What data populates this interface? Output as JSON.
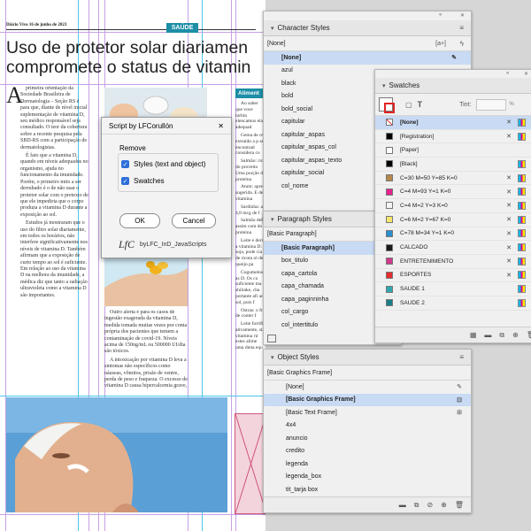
{
  "document": {
    "folio": "Diário Vivo 16 de junho de 2023",
    "section_tag": "SAÚDE",
    "headline_line1": "Uso de protetor solar diariamen",
    "headline_line2": "compromete o status de vitamin",
    "sidebar_title": "Aliment",
    "dropcap": "A",
    "column1": [
      "primeira orientação da Sociedade Brasileira de Dermatologia – Seção RS é para que, diante de nível inicial suplementação de vitamina D, seu médico responsável seja consultado. O teor da cobertura sobre a recente pesquisa pela SBD-RS com a participação de dermatologistas.",
      "É fato que a vitamina D, quando em níveis adequados no organismo, ajuda no funcionamento da imunidade. Porém, o primeiro mito a ser derrubado é o de não usar o protetor solar com o pretexto de que ele impediria que o corpo produza a vitamina D durante a exposição ao sol.",
      "Estudos já mostraram que o uso do filtro solar diariamente, em todos os horários, não interfere significativamente nos níveis de vitamina D. Também afirmam que a exposição de curto tempo ao sol é suficiente. Em relação ao uso da vitamina D na melhora da imunidade, a médica diz que tanto a radiação ultravioleta como a vitamina D são importantes."
    ],
    "column2": [
      "Outro alerta é para os casos de ingestão exagerada da vitamina D, medida tomada muitas vezes por conta própria dos pacientes que temem a contaminação de covid-19. Níveis acima de 150ng/mL ou 500000 UI/dia são tóxicos.",
      "A intoxicação por vitamina D leva a sintomas não específicos como náuseas, vômitos, prisão de ventre, perda de peso e fraqueza. O excesso de vitamina D causa hipercalcemia grave, que pode levar a lesões renal, arritmia cardíaca e manifestações neurológicas."
    ],
    "column3": [
      "Ao saber que voce turbin elencamos elas adequad",
      "Gema de ov extraído a p ser encontrad considera co",
      "Salmão: ric do proveito Uma porção de proteína",
      "Atum: apres sugerida. E de vitamina",
      "Sardinha: a 4,8 mcg de f",
      "Salmão defu assim com do proteina",
      "Leite e deriv a vitamina D: soja, pode cia de ricota ol de queijo pa",
      "Cogumelos: as D. Os co suficiente ma shiitake, cha portante afi ao sol, pois f",
      "Ostras: o fri de conter f",
      "Leite fortific ativamente, sta vitamina rir estes alime uma dieta equ"
    ]
  },
  "dialog": {
    "title": "Script by LFCorullón",
    "close": "✕",
    "group_label": "Remove",
    "options": [
      {
        "label": "Styles (text and object)",
        "checked": true
      },
      {
        "label": "Swatches",
        "checked": true
      }
    ],
    "ok_label": "OK",
    "cancel_label": "Cancel",
    "brand": "byLFC_InD_JavaScripts"
  },
  "character_styles": {
    "title": "Character Styles",
    "current": "[None]",
    "new_label": "[a+]",
    "items": [
      "[None]",
      "azul",
      "black",
      "bold",
      "bold_social",
      "capitular",
      "capitular_aspas",
      "capitular_aspas_col",
      "capitular_aspas_texto",
      "capitular_social",
      "col_nome"
    ],
    "selected": "[None]"
  },
  "paragraph_styles": {
    "title": "Paragraph Styles",
    "current": "[Basic Paragraph]",
    "items": [
      "[Basic Paragraph]",
      "box_titulo",
      "capa_cartola",
      "capa_chamada",
      "capa_paginninha",
      "col_cargo",
      "col_intertitulo"
    ],
    "selected": "[Basic Paragraph]"
  },
  "object_styles": {
    "title": "Object Styles",
    "current": "[Basic Graphics Frame]",
    "items": [
      "[None]",
      "[Basic Graphics Frame]",
      "[Basic Text Frame]",
      "4x4",
      "anuncio",
      "credito",
      "legenda",
      "legenda_box",
      "tit_tarja box"
    ],
    "selected": "[Basic Graphics Frame]"
  },
  "swatches": {
    "title": "Swatches",
    "tint_label": "Tint:",
    "tint_unit": "%",
    "items": [
      {
        "name": "[None]",
        "color": "#ffffff",
        "selected": true
      },
      {
        "name": "[Registration]",
        "color": "#000000"
      },
      {
        "name": "[Paper]",
        "color": "#ffffff"
      },
      {
        "name": "[Black]",
        "color": "#000000"
      },
      {
        "name": "C=30 M=50 Y=85 K=0",
        "color": "#b5874a"
      },
      {
        "name": "C=4 M=93 Y=1 K=0",
        "color": "#e6238e"
      },
      {
        "name": "C=4 M=2 Y=3 K=0",
        "color": "#f4f4f2"
      },
      {
        "name": "C=6 M=2 Y=67 K=0",
        "color": "#f5e66a"
      },
      {
        "name": "C=78 M=34 Y=1 K=0",
        "color": "#2a8fcf"
      },
      {
        "name": "CALCADO",
        "color": "#1a1a1a"
      },
      {
        "name": "ENTRETENIMENTO",
        "color": "#cf3a8c"
      },
      {
        "name": "ESPORTES",
        "color": "#e52d2d"
      },
      {
        "name": "SAUDE 1",
        "color": "#2ea8b0"
      },
      {
        "name": "SAUDE 2",
        "color": "#1b7f87"
      }
    ]
  },
  "colors": {
    "accent": "#1d8ea6",
    "selection": "#c8daf4",
    "checkbox": "#2e6fd8"
  }
}
